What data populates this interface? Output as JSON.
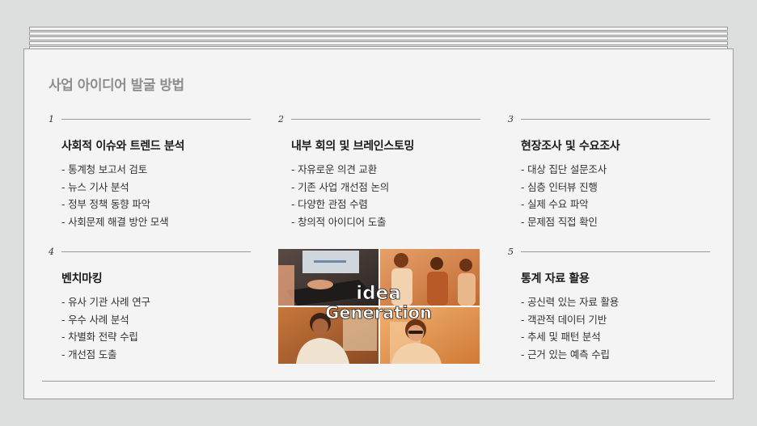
{
  "title": "사업 아이디어 발굴 방법",
  "sections": [
    {
      "num": "1",
      "heading": "사회적 이슈와 트렌드 분석",
      "items": [
        "- 통계청 보고서 검토",
        "- 뉴스 기사 분석",
        "- 정부 정책 동향 파악",
        "- 사회문제 해결 방안 모색"
      ]
    },
    {
      "num": "2",
      "heading": "내부 회의 및 브레인스토밍",
      "items": [
        "- 자유로운 의견 교환",
        "- 기존 사업 개선점 논의",
        "- 다양한 관점 수렴",
        "- 창의적 아이디어 도출"
      ]
    },
    {
      "num": "3",
      "heading": "현장조사 및 수요조사",
      "items": [
        "- 대상 집단 설문조사",
        "- 심층 인터뷰 진행",
        "- 실제 수요 파악",
        "- 문제점 직접 확인"
      ]
    },
    {
      "num": "4",
      "heading": "벤치마킹",
      "items": [
        "- 유사 기관 사례 연구",
        "- 우수 사례 분석",
        "- 차별화 전략 수립",
        "- 개선점 도출"
      ]
    },
    {
      "num": "5",
      "heading": "통계 자료 활용",
      "items": [
        "- 공신력 있는 자료 활용",
        "- 객관적 데이터 기반",
        "- 추세 및 패턴 분석",
        "- 근거 있는 예측 수립"
      ]
    }
  ],
  "photo": {
    "line1": "idea",
    "line2": "Generation"
  }
}
